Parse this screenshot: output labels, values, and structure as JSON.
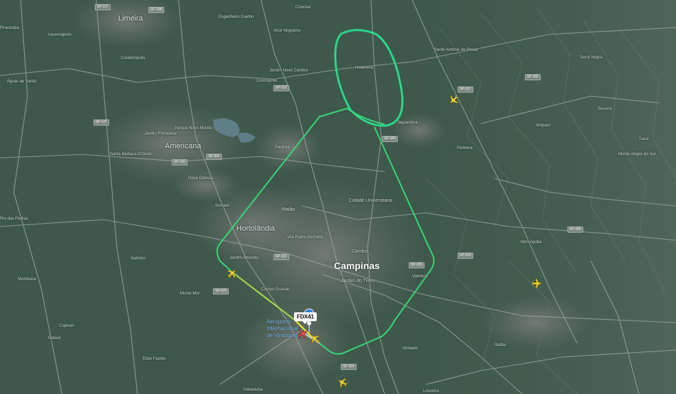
{
  "map": {
    "cities": [
      {
        "name": "Limeira",
        "size": "normal"
      },
      {
        "name": "Americana",
        "size": "normal"
      },
      {
        "name": "Hortolândia",
        "size": "normal"
      },
      {
        "name": "Campinas",
        "size": "big"
      },
      {
        "name": "Santa Bárbara d'Oeste",
        "size": "small"
      },
      {
        "name": "Nova Odessa",
        "size": "small"
      },
      {
        "name": "Sumaré",
        "size": "small"
      },
      {
        "name": "Paulínia",
        "size": "small"
      },
      {
        "name": "Cosmópolis",
        "size": "small"
      },
      {
        "name": "Holambra",
        "size": "small"
      },
      {
        "name": "Jaguariúna",
        "size": "small"
      },
      {
        "name": "Pedreira",
        "size": "small"
      },
      {
        "name": "Monte Mor",
        "size": "small"
      },
      {
        "name": "Valinhos",
        "size": "small"
      },
      {
        "name": "Vinhedo",
        "size": "small"
      },
      {
        "name": "Morungaba",
        "size": "small"
      },
      {
        "name": "Serra Negra",
        "size": "small"
      },
      {
        "name": "Santo Antônio de Posse",
        "size": "small"
      },
      {
        "name": "Artur Nogueira",
        "size": "small"
      },
      {
        "name": "Engenheiro Coelho",
        "size": "small"
      },
      {
        "name": "Conchal",
        "size": "small"
      },
      {
        "name": "Iracemápolis",
        "size": "small"
      },
      {
        "name": "Capivari",
        "size": "small"
      },
      {
        "name": "Rafard",
        "size": "small"
      },
      {
        "name": "Elias Fausto",
        "size": "small"
      },
      {
        "name": "Indaiatuba",
        "size": "small"
      },
      {
        "name": "Rio das Pedras",
        "size": "small"
      },
      {
        "name": "Piracicaba",
        "size": "small"
      },
      {
        "name": "Louveira",
        "size": "small"
      },
      {
        "name": "Itatiba",
        "size": "small"
      },
      {
        "name": "Amparo",
        "size": "small"
      },
      {
        "name": "Monte Alegre do Sul",
        "size": "small"
      },
      {
        "name": "Águas de Santa",
        "size": "small"
      },
      {
        "name": "Tuiuti",
        "size": "small"
      },
      {
        "name": "Socorro",
        "size": "small"
      },
      {
        "name": "Mombuca",
        "size": "small"
      },
      {
        "name": "Cordeirópolis",
        "size": "small"
      },
      {
        "name": "Saltinho",
        "size": "small"
      }
    ],
    "neighborhoods": [
      "Cidade Universitária",
      "Jardim do Trevo",
      "Cambuí",
      "Matão",
      "Jardim Amanda",
      "Campo Grande",
      "Vila Padre Anchieta",
      "Jardim Primavera",
      "Parque Novo Mundo",
      "Jardim Novo Cambuí"
    ],
    "road_shields": [
      "SP-348",
      "SP-330",
      "SP-340",
      "SP-065",
      "SP-101",
      "SP-324",
      "SP-304",
      "SP-332",
      "SP-107",
      "SP-360",
      "SP-063",
      "SP-083",
      "SP-075",
      "SP-147",
      "SP-127"
    ],
    "airport": {
      "name_line1": "Aeroporto",
      "name_line2": "Internacional",
      "name_line3": "de Viracopos"
    },
    "flight": {
      "callsign": "FDX41",
      "track_color": "#2bd98a",
      "approach_color": "#e3e033",
      "aircraft_color": "#f1d53a"
    },
    "colors": {
      "terrain": "#3f5a4c",
      "urban": "#6e706d",
      "water": "#5d7b86",
      "roads": "#9da3a0"
    }
  }
}
